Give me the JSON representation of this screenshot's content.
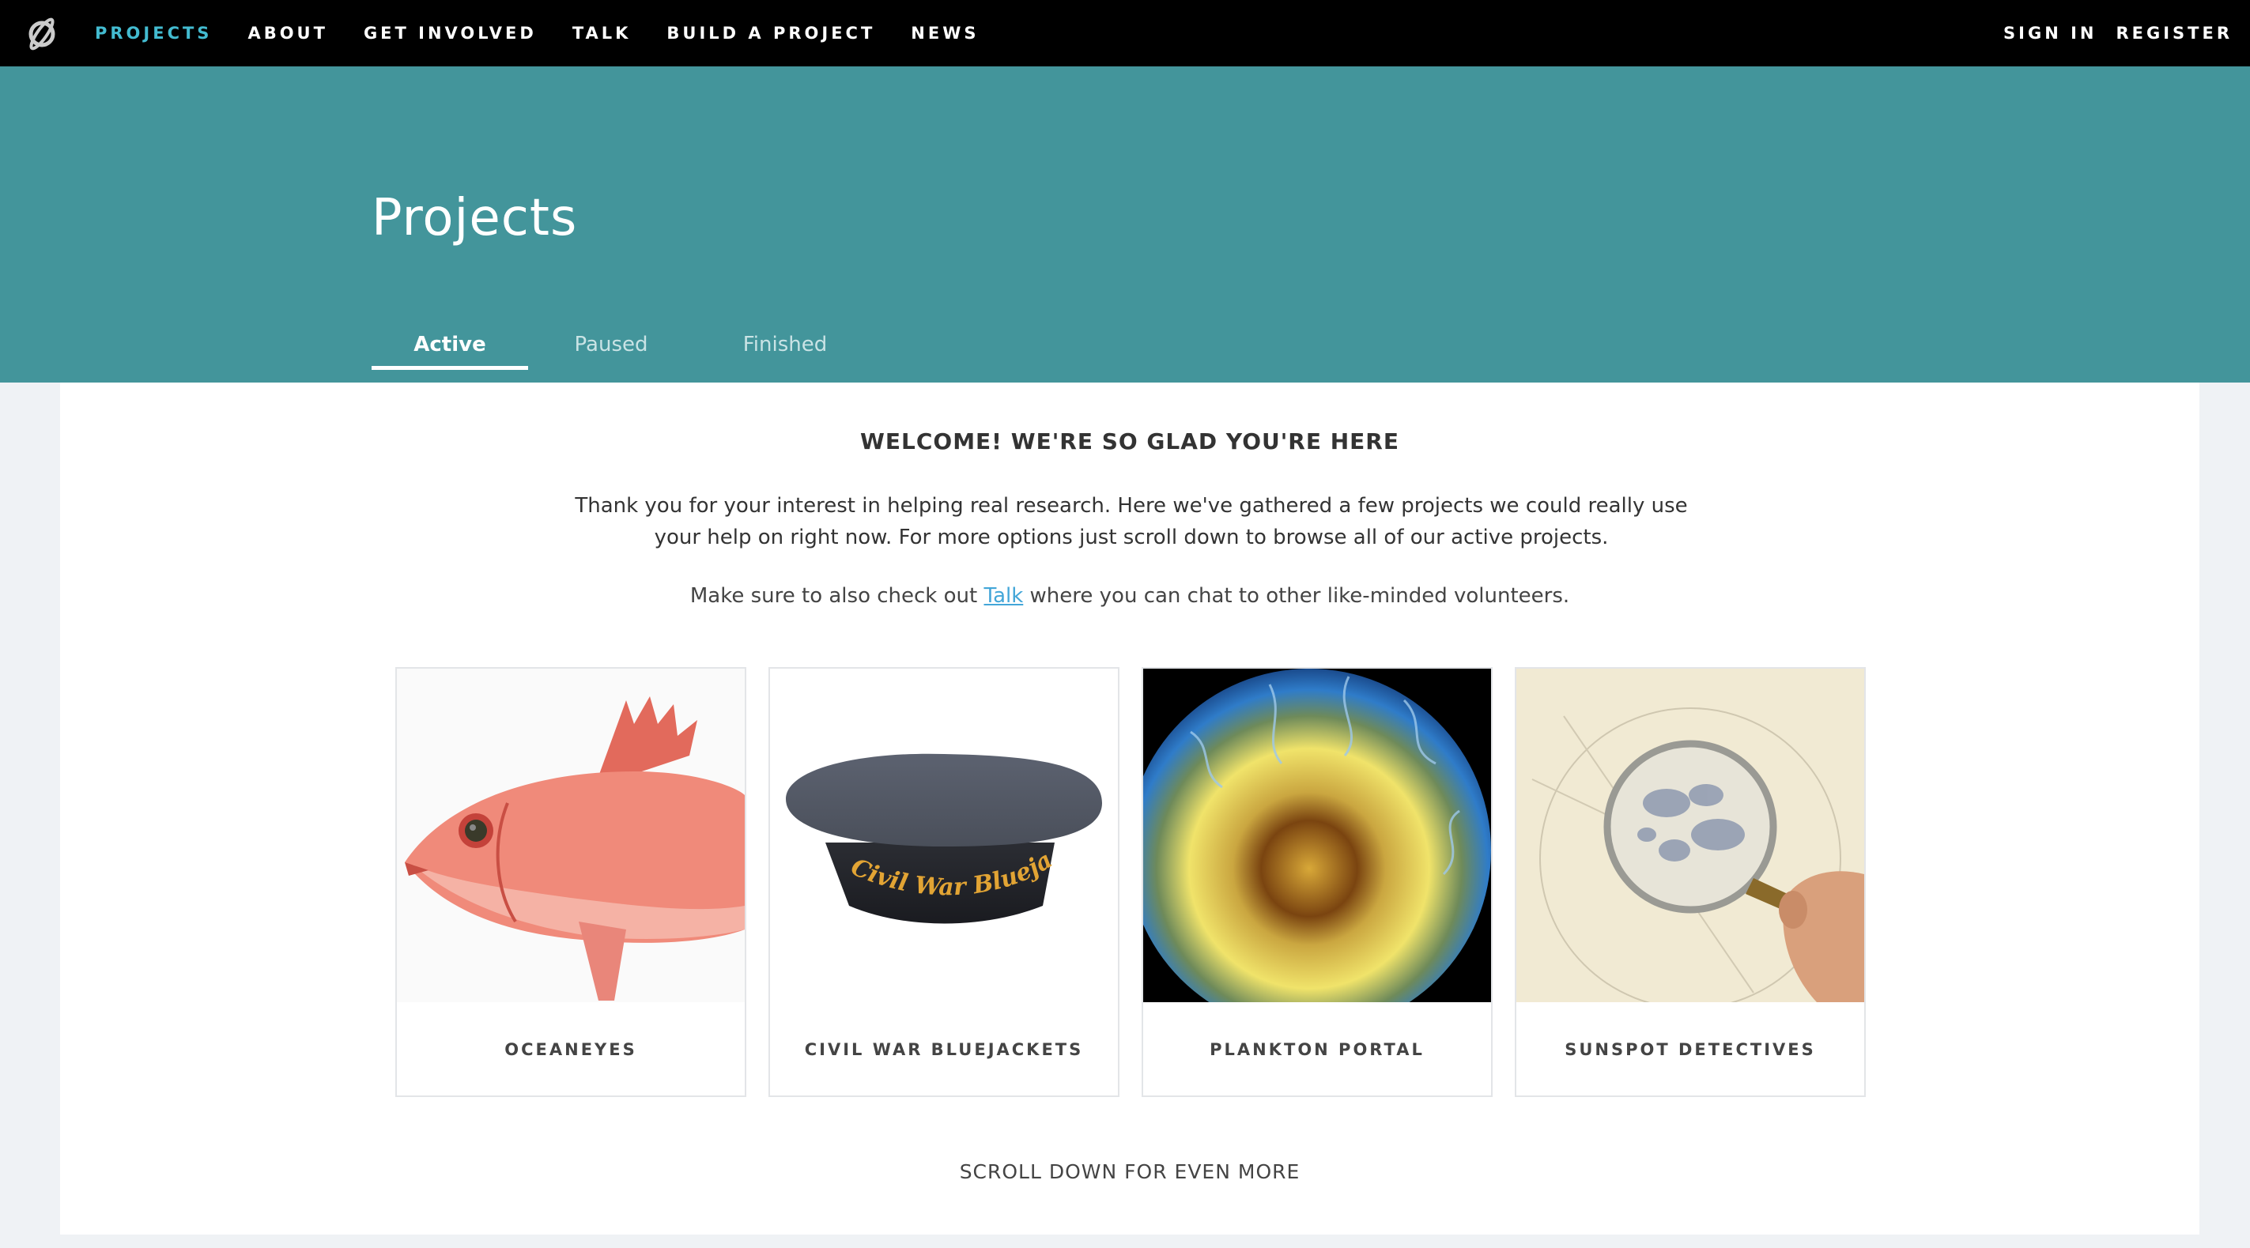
{
  "nav": {
    "logo_icon": "zooniverse-logo-icon",
    "links": [
      "Projects",
      "About",
      "Get Involved",
      "Talk",
      "Build a Project",
      "News"
    ],
    "active_link": "Projects",
    "sign_in": "Sign In",
    "register": "Register"
  },
  "hero": {
    "title": "Projects",
    "tabs": [
      "Active",
      "Paused",
      "Finished"
    ],
    "selected_tab": "Active"
  },
  "content": {
    "welcome": "WELCOME! WE'RE SO GLAD YOU'RE HERE",
    "intro": "Thank you for your interest in helping real research. Here we've gathered a few projects we could really use your help on right now. For more options just scroll down to browse all of our active projects.",
    "talk_before": "Make sure to also check out ",
    "talk_link": "Talk",
    "talk_after": " where you can chat to other like-minded volunteers.",
    "projects": [
      {
        "name": "OCEANEYES",
        "image": "red-fish-image"
      },
      {
        "name": "CIVIL WAR BLUEJACKETS",
        "image": "sailor-hat-image",
        "image_text": "Civil War Bluejackets"
      },
      {
        "name": "PLANKTON PORTAL",
        "image": "plankton-image"
      },
      {
        "name": "SUNSPOT DETECTIVES",
        "image": "magnifying-glass-sunspot-image"
      }
    ],
    "scroll_more": "SCROLL DOWN FOR EVEN MORE"
  },
  "colors": {
    "nav_bg": "#000000",
    "active_link": "#43bbd0",
    "hero_bg": "#43959b",
    "page_bg": "#eff2f5",
    "link": "#43a6d8"
  }
}
